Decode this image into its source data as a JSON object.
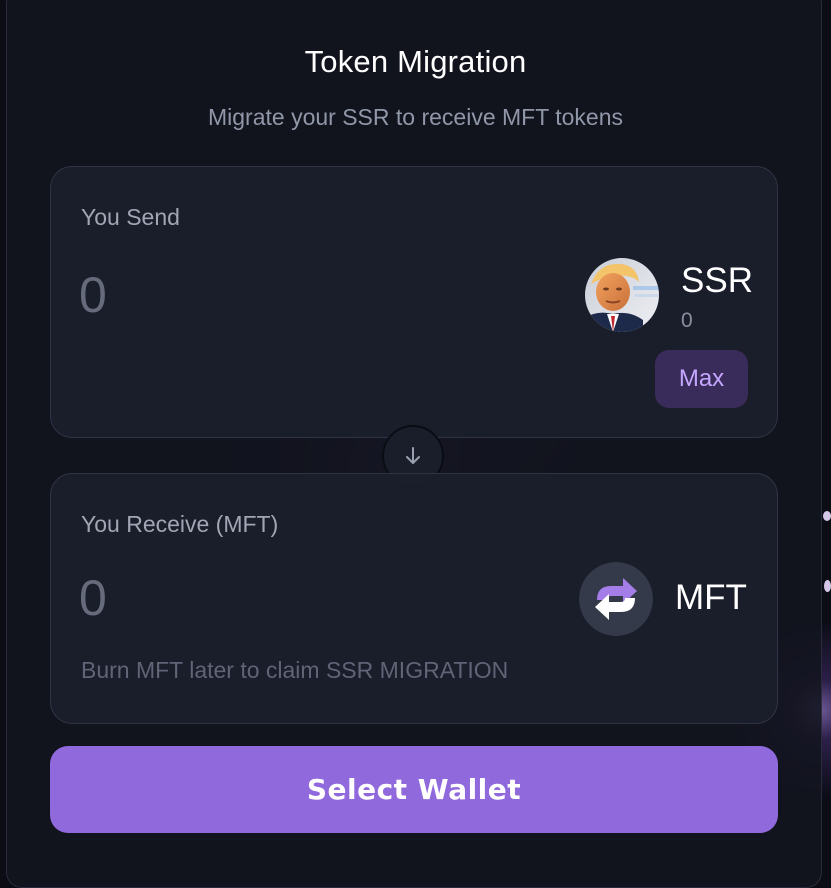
{
  "header": {
    "title": "Token Migration",
    "subtitle": "Migrate your SSR to receive MFT tokens"
  },
  "send_panel": {
    "label": "You Send",
    "amount_placeholder": "0",
    "token": {
      "symbol": "SSR",
      "balance": "0",
      "avatar_icon": "ssr-token-portrait-avatar"
    },
    "max_label": "Max"
  },
  "swap": {
    "icon": "arrow-down-icon"
  },
  "receive_panel": {
    "label": "You Receive (MFT)",
    "amount_placeholder": "0",
    "token": {
      "symbol": "MFT",
      "avatar_icon": "refresh-arrows-icon"
    },
    "hint": "Burn MFT later to claim SSR MIGRATION"
  },
  "actions": {
    "select_wallet_label": "Select Wallet"
  },
  "colors": {
    "accent": "#9069dc",
    "max_button_bg": "#3a2c5a",
    "max_button_text": "#c5a6ff",
    "panel_bg": "#1b1e2b",
    "page_bg": "#0b0c14"
  }
}
